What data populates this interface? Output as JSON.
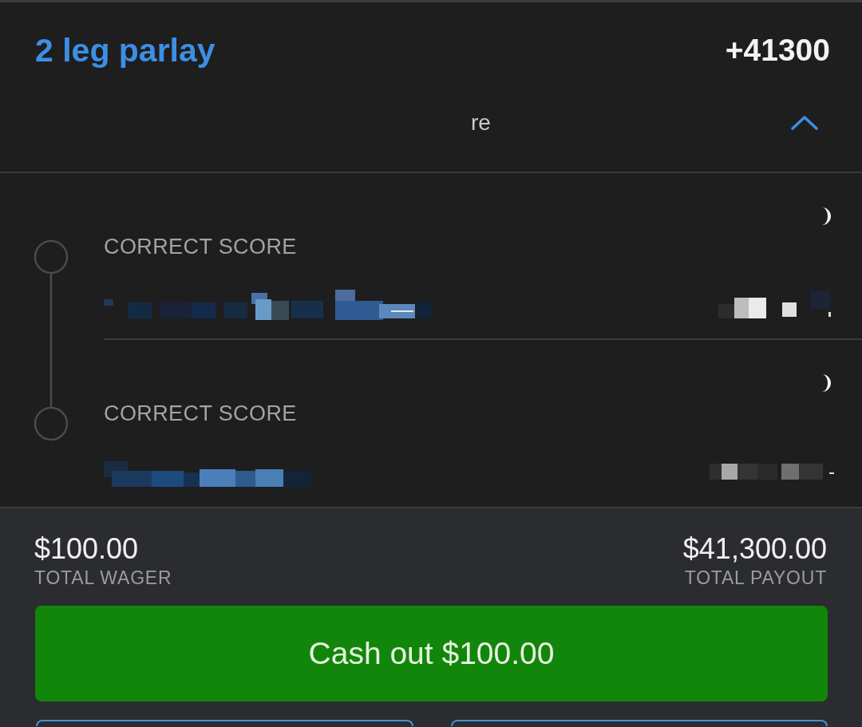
{
  "parlay": {
    "title": "2 leg parlay",
    "odds": "+41300"
  },
  "details_toggle": {
    "text": "re",
    "expanded": true
  },
  "legs": [
    {
      "market": "CORRECT SCORE"
    },
    {
      "market": "CORRECT SCORE"
    }
  ],
  "totals": [
    {
      "amount": "$100.00",
      "label": "TOTAL WAGER"
    },
    {
      "amount": "$41,300.00",
      "label": "TOTAL PAYOUT"
    }
  ],
  "cash_out_button": {
    "label": "Cash out $100.00"
  }
}
